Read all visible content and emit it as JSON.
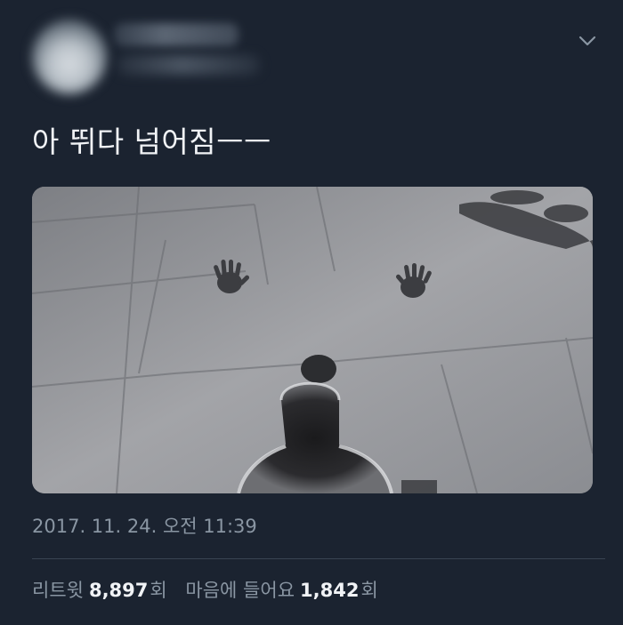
{
  "tweet": {
    "text": "아 뛰다 넘어짐ㅡㅡ",
    "timestamp": "2017. 11. 24. 오전 11:39"
  },
  "stats": {
    "retweets_label": "리트윗",
    "retweets_count": "8,897",
    "retweets_unit": "회",
    "likes_label": "마음에 들어요",
    "likes_count": "1,842",
    "likes_unit": "회"
  },
  "icons": {
    "menu": "chevron-down-icon"
  },
  "colors": {
    "background": "#1b2330",
    "text": "#f1f3f6",
    "secondary_text": "#8a96a3",
    "divider": "#3a4452"
  }
}
